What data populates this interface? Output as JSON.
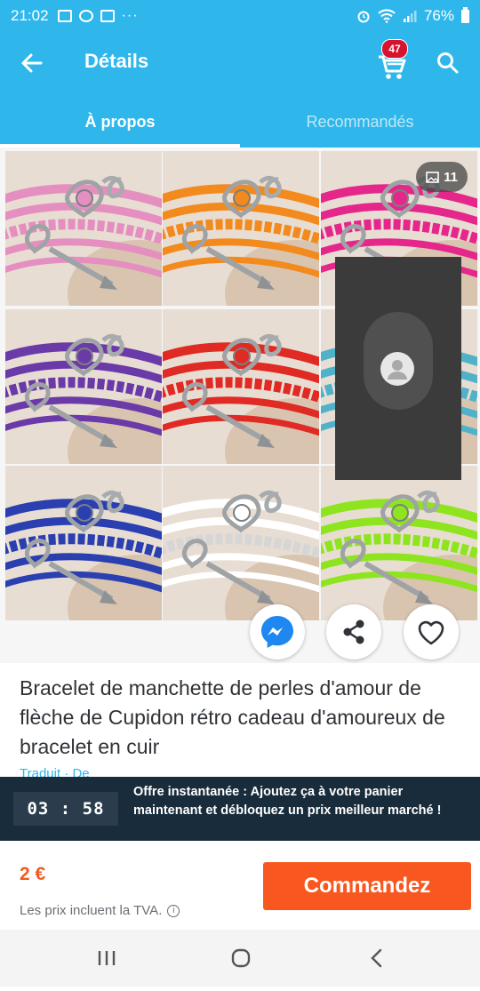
{
  "status_bar": {
    "time": "21:02",
    "battery": "76%",
    "left_icons": [
      "gallery-icon",
      "messenger-icon",
      "facebook-icon",
      "more-dots-icon"
    ],
    "right_icons": [
      "alarm-icon",
      "wifi-icon",
      "signal-icon",
      "battery-icon"
    ]
  },
  "app_bar": {
    "title": "Détails",
    "cart_count": "47",
    "colors": {
      "primary": "#2fb7ec",
      "badge": "#d7132f"
    }
  },
  "tabs": [
    {
      "label": "À propos",
      "active": true
    },
    {
      "label": "Recommandés",
      "active": false
    }
  ],
  "gallery": {
    "image_count": "11",
    "bracelet_colors": [
      "#e58fc0",
      "#f28a1e",
      "#e5278c",
      "#6a3aa8",
      "#e02a24",
      "#4fb2c9",
      "#2a3fb0",
      "#ffffff",
      "#8ee51f"
    ]
  },
  "actions": {
    "messenger": "messenger-icon",
    "share": "share-icon",
    "wishlist": "heart-icon"
  },
  "product": {
    "title": "Bracelet de manchette de perles d'amour de flèche de Cupidon rétro cadeau d'amoureux de bracelet en cuir",
    "subtext": "Traduit ·  De "
  },
  "offer": {
    "countdown": "03 : 58",
    "text": "Offre instantanée : Ajoutez ça à votre panier maintenant et débloquez un prix meilleur marché !"
  },
  "purchase": {
    "price": "2 €",
    "vat_note": "Les prix incluent la TVA.",
    "button": "Commandez",
    "colors": {
      "price": "#f25a1f",
      "button": "#f8581f"
    }
  },
  "system_nav": [
    "recent-apps-icon",
    "home-icon",
    "back-icon"
  ]
}
